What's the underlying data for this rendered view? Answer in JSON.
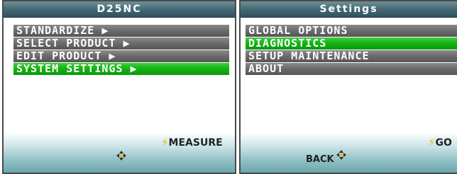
{
  "left_screen": {
    "title": "D25NC",
    "menu_items": [
      {
        "label": "STANDARDIZE ▶",
        "selected": false
      },
      {
        "label": "SELECT PRODUCT ▶",
        "selected": false
      },
      {
        "label": "EDIT PRODUCT ▶",
        "selected": false
      },
      {
        "label": "SYSTEM SETTINGS ▶",
        "selected": true
      }
    ],
    "softkey_right": "MEASURE",
    "softkey_left": ""
  },
  "right_screen": {
    "title": "Settings",
    "menu_items": [
      {
        "label": "GLOBAL OPTIONS",
        "selected": false
      },
      {
        "label": "DIAGNOSTICS",
        "selected": true
      },
      {
        "label": "SETUP MAINTENANCE",
        "selected": false
      },
      {
        "label": "ABOUT",
        "selected": false
      }
    ],
    "softkey_right": "GO",
    "softkey_left": "BACK"
  },
  "icons": {
    "softkey": "lightning-bolt-icon",
    "navigation": "four-way-dpad-icon"
  },
  "colors": {
    "title_bar": "#3f6470",
    "menu_item": "#6a6a6a",
    "menu_selected": "#13b013",
    "softkey_bolt": "#f0b800",
    "bottom_bar": "#8fc0c4"
  }
}
